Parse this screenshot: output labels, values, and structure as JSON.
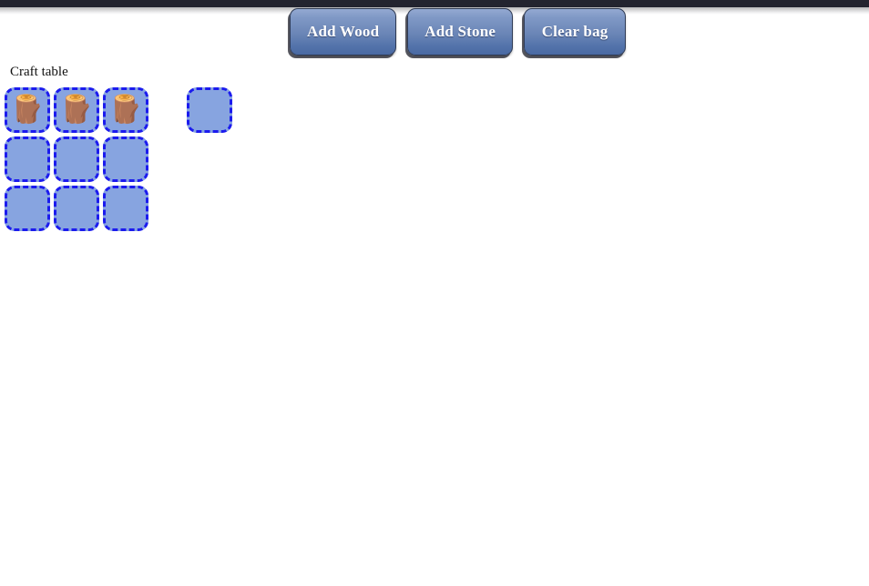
{
  "window": {
    "background_color": "#ffffff",
    "top_bar_color": "#23242f"
  },
  "toolbar": {
    "buttons": [
      {
        "label": "Add Wood",
        "name": "add-wood-button"
      },
      {
        "label": "Add Stone",
        "name": "add-stone-button"
      },
      {
        "label": "Clear bag",
        "name": "clear-bag-button"
      }
    ]
  },
  "craft_table": {
    "label": "Craft table",
    "slot_fill_color": "#87a4e0",
    "slot_border_color": "#1b1bee",
    "rows": 3,
    "columns": 3,
    "cells": [
      {
        "item": "wood-log",
        "glyph": "🪵"
      },
      {
        "item": "wood-log",
        "glyph": "🪵"
      },
      {
        "item": "wood-log",
        "glyph": "🪵"
      },
      {
        "item": "",
        "glyph": ""
      },
      {
        "item": "",
        "glyph": ""
      },
      {
        "item": "",
        "glyph": ""
      },
      {
        "item": "",
        "glyph": ""
      },
      {
        "item": "",
        "glyph": ""
      },
      {
        "item": "",
        "glyph": ""
      }
    ]
  },
  "bag": {
    "slots": [
      {
        "item": "",
        "glyph": ""
      }
    ]
  }
}
